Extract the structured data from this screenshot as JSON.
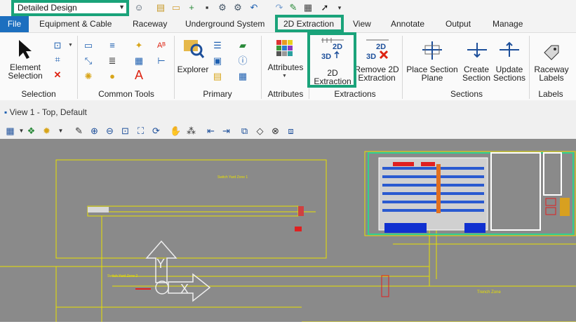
{
  "qat": {
    "workflow_value": "Detailed Design",
    "icons": [
      "user-icon",
      "open-folder-icon",
      "folder-icon",
      "new-file-icon",
      "save-icon",
      "settings-icon",
      "compress-icon",
      "undo-icon",
      "redo-icon",
      "pin-icon",
      "print-icon",
      "select-cursor-icon",
      "more-icon"
    ]
  },
  "tabs": {
    "file": "File",
    "items": [
      "Equipment & Cable",
      "Raceway",
      "Underground System",
      "2D Extraction",
      "View",
      "Annotate",
      "Output",
      "Manage"
    ]
  },
  "ribbon": {
    "element_selection": "Element Selection",
    "groups": {
      "selection": "Selection",
      "common_tools": "Common Tools",
      "primary": "Primary",
      "attributes": "Attributes",
      "extractions": "Extractions",
      "sections": "Sections",
      "labels": "Labels"
    },
    "explorer": "Explorer",
    "attributes_btn": "Attributes",
    "extraction_2d": "2D Extraction",
    "remove_2d": "Remove 2D Extraction",
    "place_section": "Place Section Plane",
    "create_section": "Create Section",
    "update_sections": "Update Sections",
    "raceway_labels": "Raceway Labels",
    "icon_2d": "2D",
    "icon_3d": "3D"
  },
  "view": {
    "title": "View 1 - Top, Default"
  },
  "drawing": {
    "label_zone1": "Switch Yard Zone 1",
    "label_zone2": "Switch Yard Zone 2",
    "label_trench": "Trench Zone",
    "axis_y": "Y",
    "axis_x": "X"
  },
  "colors": {
    "accent": "#1aa37a",
    "file_tab": "#1c6fbf",
    "canvas": "#8a8a8a",
    "drawing_line": "#e8e000"
  }
}
